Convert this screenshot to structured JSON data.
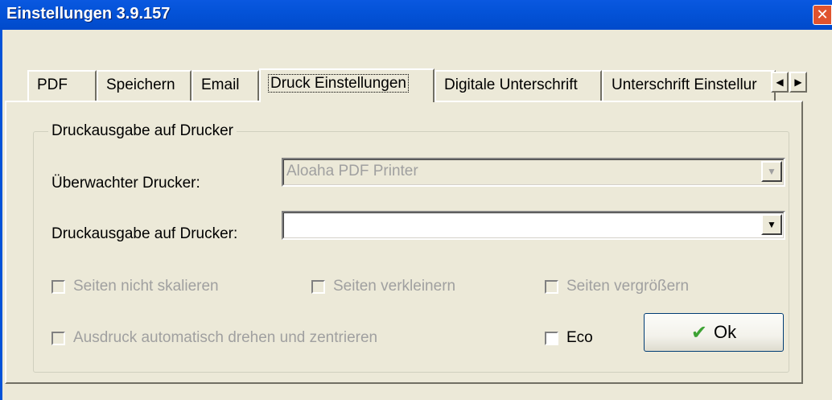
{
  "window": {
    "title": "Einstellungen 3.9.157",
    "close_glyph": "✕"
  },
  "tabs": [
    {
      "label": "PDF"
    },
    {
      "label": "Speichern"
    },
    {
      "label": "Email"
    },
    {
      "label": "Druck Einstellungen",
      "active": true
    },
    {
      "label": "Digitale Unterschrift"
    },
    {
      "label": "Unterschrift Einstellur"
    }
  ],
  "tab_scroll": {
    "left_glyph": "◀",
    "right_glyph": "▶"
  },
  "group": {
    "title": "Druckausgabe auf Drucker",
    "monitored_printer_label": "Überwachter Drucker:",
    "monitored_printer_value": "Aloaha PDF Printer",
    "output_printer_label": "Druckausgabe auf Drucker:",
    "output_printer_value": "",
    "dropdown_glyph": "▼"
  },
  "options": {
    "no_scale": "Seiten nicht skalieren",
    "shrink": "Seiten verkleinern",
    "enlarge": "Seiten vergrößern",
    "auto_rotate": "Ausdruck automatisch drehen und zentrieren",
    "eco": "Eco"
  },
  "ok_button": {
    "label": "Ok",
    "icon": "check-icon",
    "glyph": "✔"
  }
}
